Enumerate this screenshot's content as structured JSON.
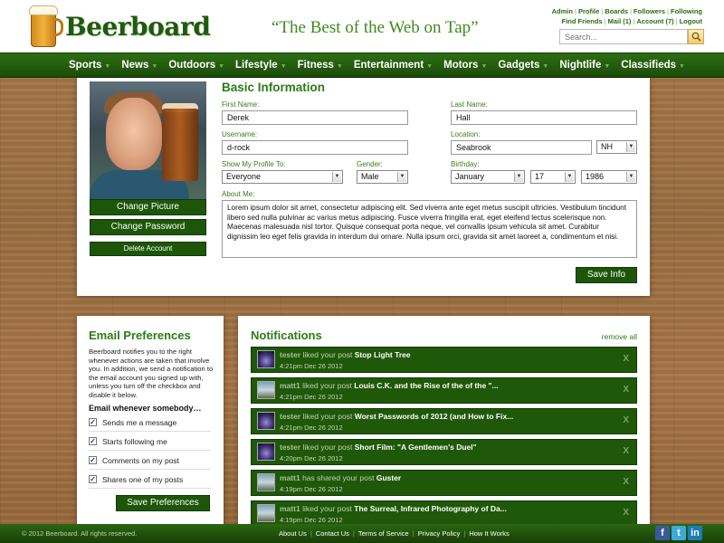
{
  "header": {
    "logo_text": "Beerboard",
    "tagline": "“The Best of the Web on Tap”",
    "links_row1": [
      "Admin",
      "Profile",
      "Boards",
      "Followers",
      "Following"
    ],
    "links_row2": [
      "Find Friends",
      "Mail (1)",
      "Account (7)",
      "Logout"
    ],
    "search_placeholder": "Search..."
  },
  "nav": [
    "Sports",
    "News",
    "Outdoors",
    "Lifestyle",
    "Fitness",
    "Entertainment",
    "Motors",
    "Gadgets",
    "Nightlife",
    "Classifieds"
  ],
  "profile_sidebar": {
    "change_picture": "Change Picture",
    "change_password": "Change Password",
    "delete_account": "Delete Account"
  },
  "basic_info": {
    "title": "Basic Information",
    "first_name_label": "First Name:",
    "first_name": "Derek",
    "last_name_label": "Last Name:",
    "last_name": "Hall",
    "username_label": "Username:",
    "username": "d-rock",
    "location_label": "Location:",
    "location": "Seabrook",
    "state": "NH",
    "show_profile_label": "Show My Profile To:",
    "show_profile": "Everyone",
    "gender_label": "Gender:",
    "gender": "Male",
    "birthday_label": "Birthday:",
    "birth_month": "January",
    "birth_day": "17",
    "birth_year": "1986",
    "about_label": "About Me:",
    "about": "Lorem ipsum dolor sit amet, consectetur adipiscing elit. Sed viverra ante eget metus suscipit ultricies. Vestibulum tincidunt libero sed nulla pulvinar ac varius metus adipiscing. Fusce viverra fringilla erat, eget eleifend lectus scelerisque non. Maecenas malesuada nisl tortor. Quisque consequat porta neque, vel convallis ipsum vehicula sit amet. Curabitur dignissim leo eget felis gravida in interdum dui ornare. Nulla ipsum orci, gravida sit amet laoreet a, condimentum et nisi.",
    "save_label": "Save Info"
  },
  "email_prefs": {
    "title": "Email Preferences",
    "description": "Beerboard notifies you to the right whenever actions are taken that involve you. In addition, we send a notification to the email account you signed up with, unless you turn off the checkbox and disable it below.",
    "subtitle": "Email whenever somebody…",
    "options": [
      {
        "label": "Sends me a message",
        "checked": true
      },
      {
        "label": "Starts following me",
        "checked": true
      },
      {
        "label": "Comments on my post",
        "checked": true
      },
      {
        "label": "Shares one of my posts",
        "checked": true
      }
    ],
    "save_label": "Save Preferences"
  },
  "notifications": {
    "title": "Notifications",
    "remove_all": "remove all",
    "close_glyph": "X",
    "items": [
      {
        "user": "tester",
        "action": "liked your post",
        "post": "Stop Light Tree",
        "time": "4:21pm Dec 26 2012"
      },
      {
        "user": "matt1",
        "action": "liked your post",
        "post": "Louis C.K. and the Rise of the of the \"...",
        "time": "4:21pm Dec 26 2012"
      },
      {
        "user": "tester",
        "action": "liked your post",
        "post": "Worst Passwords of 2012 (and How to Fix...",
        "time": "4:21pm Dec 26 2012"
      },
      {
        "user": "tester",
        "action": "liked your post",
        "post": "Short Film: \"A Gentlemen's Duel\"",
        "time": "4:20pm Dec 26 2012"
      },
      {
        "user": "matt1",
        "action": "has shared your post",
        "post": "Guster",
        "time": "4:19pm Dec 26 2012"
      },
      {
        "user": "matt1",
        "action": "liked your post",
        "post": "The Surreal, Infrared Photography of Da...",
        "time": "4:19pm Dec 26 2012"
      }
    ]
  },
  "footer": {
    "copyright": "© 2012 Beerboard. All rights reserved.",
    "links": [
      "About Us",
      "Contact Us",
      "Terms of Service",
      "Privacy Policy",
      "How It Works"
    ],
    "social": [
      {
        "name": "facebook-icon",
        "glyph": "f",
        "color": "#3b5998"
      },
      {
        "name": "twitter-icon",
        "glyph": "t",
        "color": "#3fa9dc"
      },
      {
        "name": "linkedin-icon",
        "glyph": "in",
        "color": "#1d7bb6"
      }
    ]
  },
  "colors": {
    "brand_green": "#1d5608",
    "accent_green": "#2e7a18",
    "wood": "#a8784a"
  }
}
